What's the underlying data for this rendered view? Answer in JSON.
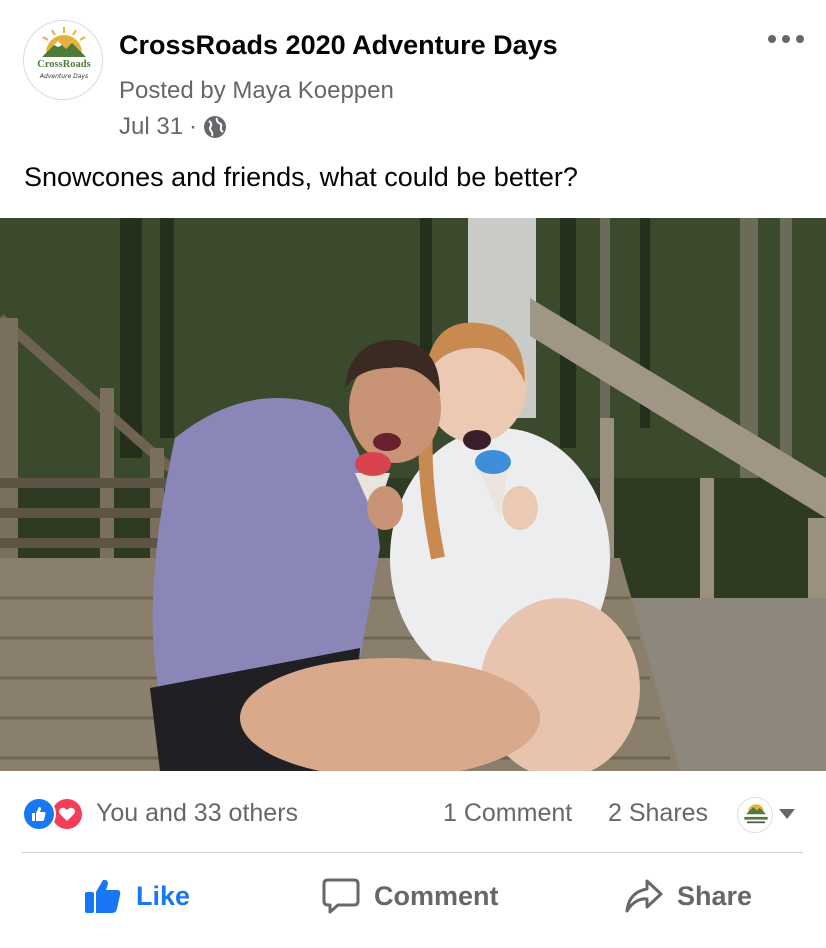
{
  "post": {
    "page_name": "CrossRoads 2020 Adventure Days",
    "posted_by": "Posted by Maya Koeppen",
    "date": "Jul 31",
    "separator": "·",
    "audience_icon": "globe-icon",
    "caption": "Snowcones and friends, what could be better?",
    "more_icon": "more-options-icon"
  },
  "logo": {
    "line1": "CrossRoads",
    "line2": "Adventure Days"
  },
  "reactions": {
    "count_text": "You and 33 others",
    "comments_text": "1 Comment",
    "shares_text": "2 Shares",
    "icons": [
      "like-reaction-icon",
      "love-reaction-icon"
    ]
  },
  "actions": {
    "like_label": "Like",
    "comment_label": "Comment",
    "share_label": "Share"
  },
  "colors": {
    "accent": "#1877f2",
    "secondary_text": "#65676b",
    "love": "#f33e58",
    "logo_green": "#4f7a3a",
    "logo_sun": "#e3b23c"
  }
}
